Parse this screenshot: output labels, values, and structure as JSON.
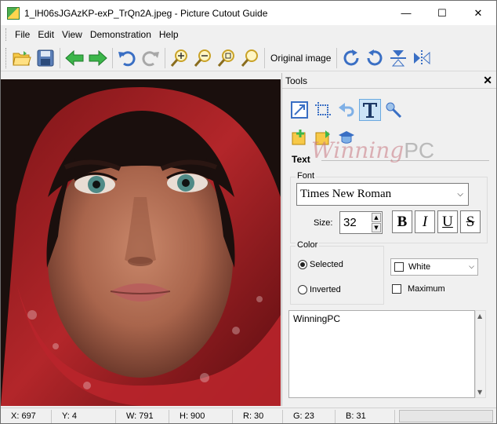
{
  "window": {
    "title": "1_lH06sJGAzKP-exP_TrQn2A.jpeg - Picture Cutout Guide",
    "controls": {
      "minimize": "—",
      "maximize": "☐",
      "close": "✕"
    }
  },
  "menu": [
    "File",
    "Edit",
    "View",
    "Demonstration",
    "Help"
  ],
  "toolbar": {
    "original_image_label": "Original image",
    "icons": [
      "open-folder-icon",
      "save-icon",
      "back-arrow-icon",
      "forward-arrow-icon",
      "undo-icon",
      "redo-icon",
      "zoom-in-icon",
      "zoom-out-icon",
      "zoom-fit-icon",
      "zoom-actual-icon",
      "rotate-right-icon",
      "rotate-left-icon",
      "flip-vertical-icon",
      "flip-horizontal-icon"
    ]
  },
  "tools_panel": {
    "title": "Tools",
    "close": "✕",
    "watermark": {
      "main": "Winning",
      "suffix": "PC"
    },
    "text_section": {
      "title": "Text",
      "font_group_label": "Font",
      "font_value": "Times New Roman",
      "size_label": "Size:",
      "size_value": "32",
      "style_buttons": {
        "bold": "B",
        "italic": "I",
        "underline": "U",
        "strike": "S"
      },
      "color_group_label": "Color",
      "radio_selected": "Selected",
      "radio_inverted": "Inverted",
      "color_value": "White",
      "maximum_label": "Maximum",
      "text_value": "WinningPC"
    }
  },
  "status": {
    "x": "X: 697",
    "y": "Y: 4",
    "w": "W: 791",
    "h": "H: 900",
    "r": "R: 30",
    "g": "G: 23",
    "b": "B: 31"
  }
}
